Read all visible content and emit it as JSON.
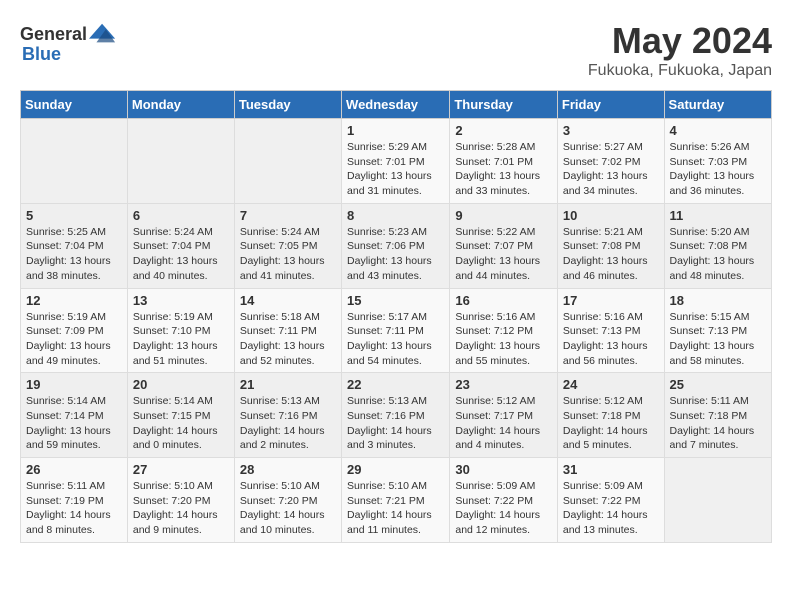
{
  "header": {
    "logo_general": "General",
    "logo_blue": "Blue",
    "month": "May 2024",
    "location": "Fukuoka, Fukuoka, Japan"
  },
  "weekdays": [
    "Sunday",
    "Monday",
    "Tuesday",
    "Wednesday",
    "Thursday",
    "Friday",
    "Saturday"
  ],
  "weeks": [
    [
      {
        "day": "",
        "info": ""
      },
      {
        "day": "",
        "info": ""
      },
      {
        "day": "",
        "info": ""
      },
      {
        "day": "1",
        "info": "Sunrise: 5:29 AM\nSunset: 7:01 PM\nDaylight: 13 hours\nand 31 minutes."
      },
      {
        "day": "2",
        "info": "Sunrise: 5:28 AM\nSunset: 7:01 PM\nDaylight: 13 hours\nand 33 minutes."
      },
      {
        "day": "3",
        "info": "Sunrise: 5:27 AM\nSunset: 7:02 PM\nDaylight: 13 hours\nand 34 minutes."
      },
      {
        "day": "4",
        "info": "Sunrise: 5:26 AM\nSunset: 7:03 PM\nDaylight: 13 hours\nand 36 minutes."
      }
    ],
    [
      {
        "day": "5",
        "info": "Sunrise: 5:25 AM\nSunset: 7:04 PM\nDaylight: 13 hours\nand 38 minutes."
      },
      {
        "day": "6",
        "info": "Sunrise: 5:24 AM\nSunset: 7:04 PM\nDaylight: 13 hours\nand 40 minutes."
      },
      {
        "day": "7",
        "info": "Sunrise: 5:24 AM\nSunset: 7:05 PM\nDaylight: 13 hours\nand 41 minutes."
      },
      {
        "day": "8",
        "info": "Sunrise: 5:23 AM\nSunset: 7:06 PM\nDaylight: 13 hours\nand 43 minutes."
      },
      {
        "day": "9",
        "info": "Sunrise: 5:22 AM\nSunset: 7:07 PM\nDaylight: 13 hours\nand 44 minutes."
      },
      {
        "day": "10",
        "info": "Sunrise: 5:21 AM\nSunset: 7:08 PM\nDaylight: 13 hours\nand 46 minutes."
      },
      {
        "day": "11",
        "info": "Sunrise: 5:20 AM\nSunset: 7:08 PM\nDaylight: 13 hours\nand 48 minutes."
      }
    ],
    [
      {
        "day": "12",
        "info": "Sunrise: 5:19 AM\nSunset: 7:09 PM\nDaylight: 13 hours\nand 49 minutes."
      },
      {
        "day": "13",
        "info": "Sunrise: 5:19 AM\nSunset: 7:10 PM\nDaylight: 13 hours\nand 51 minutes."
      },
      {
        "day": "14",
        "info": "Sunrise: 5:18 AM\nSunset: 7:11 PM\nDaylight: 13 hours\nand 52 minutes."
      },
      {
        "day": "15",
        "info": "Sunrise: 5:17 AM\nSunset: 7:11 PM\nDaylight: 13 hours\nand 54 minutes."
      },
      {
        "day": "16",
        "info": "Sunrise: 5:16 AM\nSunset: 7:12 PM\nDaylight: 13 hours\nand 55 minutes."
      },
      {
        "day": "17",
        "info": "Sunrise: 5:16 AM\nSunset: 7:13 PM\nDaylight: 13 hours\nand 56 minutes."
      },
      {
        "day": "18",
        "info": "Sunrise: 5:15 AM\nSunset: 7:13 PM\nDaylight: 13 hours\nand 58 minutes."
      }
    ],
    [
      {
        "day": "19",
        "info": "Sunrise: 5:14 AM\nSunset: 7:14 PM\nDaylight: 13 hours\nand 59 minutes."
      },
      {
        "day": "20",
        "info": "Sunrise: 5:14 AM\nSunset: 7:15 PM\nDaylight: 14 hours\nand 0 minutes."
      },
      {
        "day": "21",
        "info": "Sunrise: 5:13 AM\nSunset: 7:16 PM\nDaylight: 14 hours\nand 2 minutes."
      },
      {
        "day": "22",
        "info": "Sunrise: 5:13 AM\nSunset: 7:16 PM\nDaylight: 14 hours\nand 3 minutes."
      },
      {
        "day": "23",
        "info": "Sunrise: 5:12 AM\nSunset: 7:17 PM\nDaylight: 14 hours\nand 4 minutes."
      },
      {
        "day": "24",
        "info": "Sunrise: 5:12 AM\nSunset: 7:18 PM\nDaylight: 14 hours\nand 5 minutes."
      },
      {
        "day": "25",
        "info": "Sunrise: 5:11 AM\nSunset: 7:18 PM\nDaylight: 14 hours\nand 7 minutes."
      }
    ],
    [
      {
        "day": "26",
        "info": "Sunrise: 5:11 AM\nSunset: 7:19 PM\nDaylight: 14 hours\nand 8 minutes."
      },
      {
        "day": "27",
        "info": "Sunrise: 5:10 AM\nSunset: 7:20 PM\nDaylight: 14 hours\nand 9 minutes."
      },
      {
        "day": "28",
        "info": "Sunrise: 5:10 AM\nSunset: 7:20 PM\nDaylight: 14 hours\nand 10 minutes."
      },
      {
        "day": "29",
        "info": "Sunrise: 5:10 AM\nSunset: 7:21 PM\nDaylight: 14 hours\nand 11 minutes."
      },
      {
        "day": "30",
        "info": "Sunrise: 5:09 AM\nSunset: 7:22 PM\nDaylight: 14 hours\nand 12 minutes."
      },
      {
        "day": "31",
        "info": "Sunrise: 5:09 AM\nSunset: 7:22 PM\nDaylight: 14 hours\nand 13 minutes."
      },
      {
        "day": "",
        "info": ""
      }
    ]
  ]
}
